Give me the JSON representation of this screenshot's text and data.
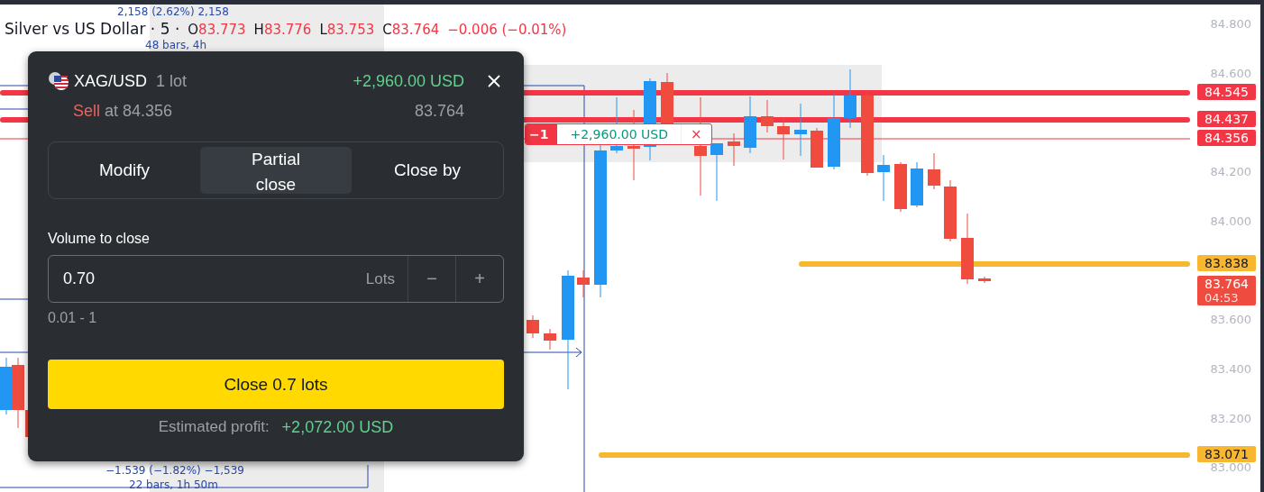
{
  "legend": {
    "title": "Silver vs US Dollar · 5 ·",
    "ohlc": [
      {
        "label": "O",
        "value": "83.773"
      },
      {
        "label": "H",
        "value": "83.776"
      },
      {
        "label": "L",
        "value": "83.753"
      },
      {
        "label": "C",
        "value": "83.764"
      }
    ],
    "change": "−0.006 (−0.01%)"
  },
  "measurements": [
    {
      "text": "2,158 (2.62%) 2,158"
    },
    {
      "text": "48 bars, 4h"
    },
    {
      "text": "−1.539 (−1.82%) −1,539"
    },
    {
      "text": "22 bars, 1h 50m"
    }
  ],
  "position_label": {
    "quantity": "−1",
    "profit": "+2,960.00 USD",
    "close": "×"
  },
  "price_axis": {
    "ticks": [
      "84.800",
      "84.600",
      "84.200",
      "84.000",
      "83.600",
      "83.400",
      "83.200",
      "83.000"
    ]
  },
  "price_tags": [
    {
      "value": "84.545",
      "color": "#f23645",
      "kind": "thick"
    },
    {
      "value": "84.437",
      "color": "#f23645",
      "kind": "thick"
    },
    {
      "value": "84.356",
      "color": "#f23645",
      "kind": "thin"
    },
    {
      "value": "83.838",
      "color": "#f7b731",
      "kind": "thick"
    },
    {
      "value": "83.764",
      "timer": "04:53",
      "color": "#ef4b3f",
      "kind": "none"
    },
    {
      "value": "83.071",
      "color": "#f7b731",
      "kind": "thick"
    }
  ],
  "dialog": {
    "symbol": "XAG/USD",
    "size": "1 lot",
    "pnl": "+2,960.00 USD",
    "side": "Sell",
    "entry": "at 84.356",
    "current": "83.764",
    "tabs": [
      {
        "label": "Modify",
        "selected": false
      },
      {
        "label": "Partial close",
        "selected": true
      },
      {
        "label": "Close by",
        "selected": false
      }
    ],
    "volume_label": "Volume to close",
    "volume_value": "0.70",
    "unit": "Lots",
    "minus": "−",
    "plus": "+",
    "range": "0.01 - 1",
    "action": "Close 0.7 lots",
    "estimate_label": "Estimated profit:",
    "estimate_value": "+2,072.00 USD"
  }
}
